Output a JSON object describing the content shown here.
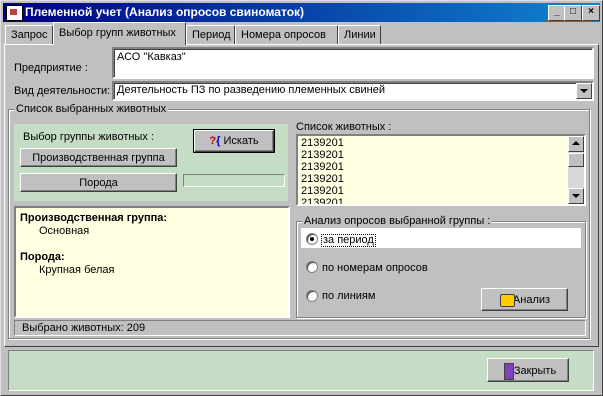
{
  "window": {
    "title": "Племенной учет (Анализ опросов свиноматок)"
  },
  "tabs": [
    {
      "label": "Запрос"
    },
    {
      "label": "Выбор групп животных"
    },
    {
      "label": "Период"
    },
    {
      "label": "Номера опросов"
    },
    {
      "label": "Линии"
    }
  ],
  "form": {
    "enterprise_label": "Предприятие :",
    "enterprise_value": "АСО \"Кавказ\"",
    "activity_label": "Вид деятельности:",
    "activity_value": "Деятельность ПЗ по разведению племенных свиней"
  },
  "selected_animals": {
    "group_title": "Список выбранных животных",
    "choose_group_label": "Выбор группы животных :",
    "search_button": "Искать",
    "production_group_button": "Производственная группа",
    "breed_button": "Порода",
    "info": {
      "production_group_heading": "Производственная группа:",
      "production_group_value": "Основная",
      "breed_heading": "Порода:",
      "breed_value": "Крупная белая"
    },
    "animal_list_label": "Список животных :",
    "animal_list": [
      "2139201",
      "2139201",
      "2139201",
      "2139201",
      "2139201",
      "2139201"
    ],
    "analysis": {
      "title": "Анализ опросов выбранной группы :",
      "options": [
        {
          "label": "за период",
          "selected": true
        },
        {
          "label": "по номерам опросов",
          "selected": false
        },
        {
          "label": "по линиям",
          "selected": false
        }
      ],
      "analyze_button": "Анализ"
    },
    "status": "Выбрано животных: 209"
  },
  "footer": {
    "close_button": "Закрыть"
  }
}
